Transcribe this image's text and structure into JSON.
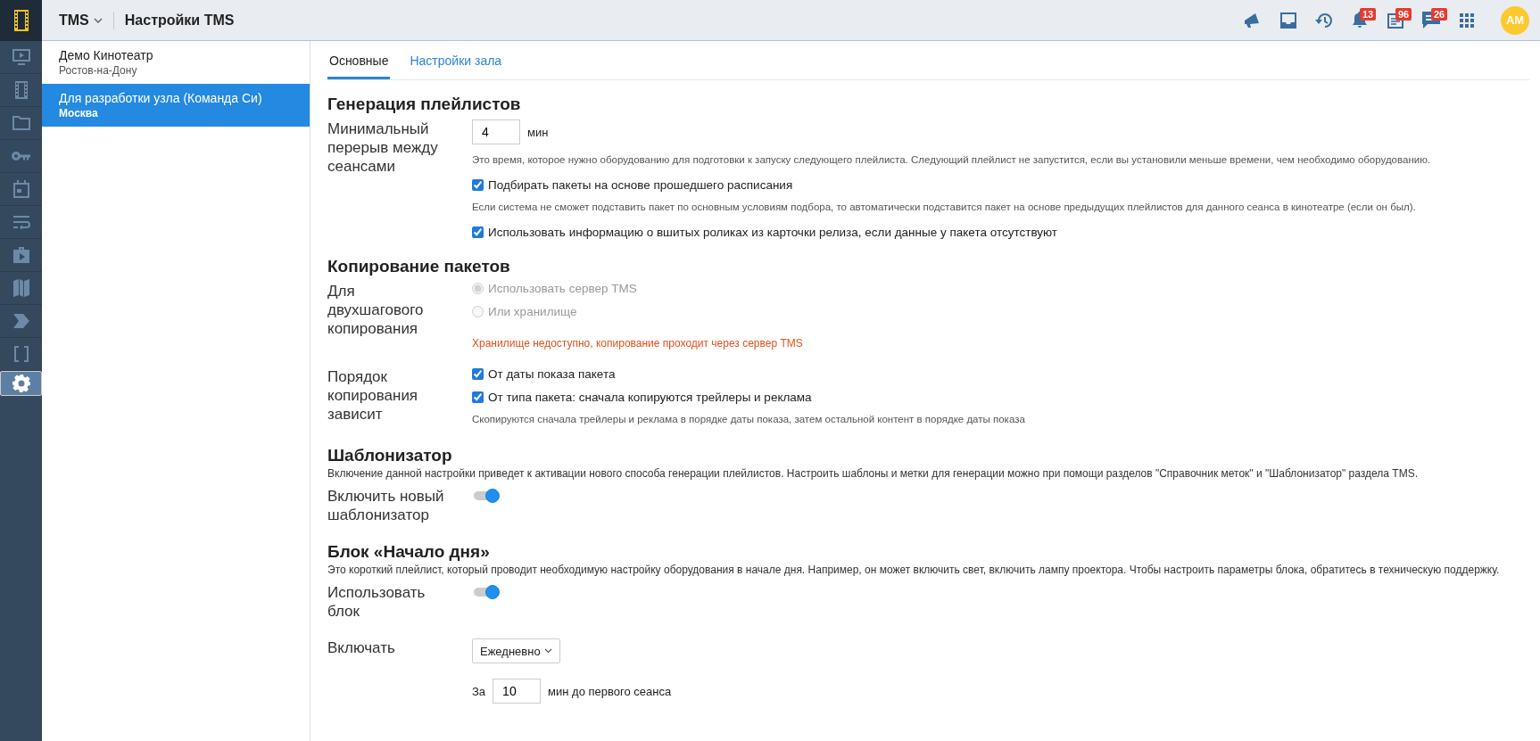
{
  "header": {
    "app": "TMS",
    "title": "Настройки TMS",
    "avatar": "AM"
  },
  "toolbar": [
    {
      "kind": "announce"
    },
    {
      "kind": "inbox"
    },
    {
      "kind": "history"
    },
    {
      "kind": "alerts",
      "badge": "13"
    },
    {
      "kind": "tasks",
      "badge": "96"
    },
    {
      "kind": "messages",
      "badge": "26"
    },
    {
      "kind": "apps"
    }
  ],
  "nav": [
    {
      "selected": false
    },
    {
      "selected": false
    },
    {
      "selected": false
    },
    {
      "selected": false
    },
    {
      "selected": false
    },
    {
      "selected": false
    },
    {
      "selected": false
    },
    {
      "selected": false
    },
    {
      "selected": false
    },
    {
      "selected": false
    },
    {
      "selected": true
    }
  ],
  "cinemas": [
    {
      "name": "Демо Кинотеатр",
      "city": "Ростов-на-Дону",
      "selected": false
    },
    {
      "name": "Для разработки узла (Команда Си)",
      "city": "Москва",
      "selected": true
    }
  ],
  "tabs": [
    {
      "label": "Основные",
      "selected": true
    },
    {
      "label": "Настройки зала",
      "selected": false
    }
  ],
  "sections": [
    {
      "title": "Генерация плейлистов",
      "rows": [
        {
          "label": "Минимальный перерыв между сеансами",
          "items": [
            {
              "kind": "number",
              "value": "4",
              "unit": "мин"
            },
            {
              "kind": "hint",
              "text": "Это время, которое нужно оборудованию для подготовки к запуску следующего плейлиста. Следующий плейлист не запустится, если вы установили меньше времени, чем необходимо оборудованию."
            },
            {
              "kind": "checkbox",
              "label": "Подбирать пакеты на основе прошедшего расписания",
              "checked": true
            },
            {
              "kind": "hint",
              "text": "Если система не сможет подставить пакет по основным условиям подбора, то автоматически подставится пакет на основе предыдущих плейлистов для данного сеанса в кинотеатре (если он был)."
            },
            {
              "kind": "checkbox",
              "label": "Использовать информацию о вшитых роликах из карточки релиза, если данные у пакета отсутствуют",
              "checked": true
            }
          ]
        }
      ]
    },
    {
      "title": "Копирование пакетов",
      "rows": [
        {
          "label": "Для двухшагового копирования",
          "items": [
            {
              "kind": "radio",
              "label": "Использовать сервер TMS",
              "selected": true,
              "disabled": true
            },
            {
              "kind": "radio",
              "label": "Или хранилище",
              "selected": false,
              "disabled": true
            },
            {
              "kind": "warning",
              "text": "Хранилище недоступно, копирование проходит через сервер TMS"
            }
          ]
        },
        {
          "label": "Порядок копирования зависит",
          "items": [
            {
              "kind": "checkbox",
              "label": "От даты показа пакета",
              "checked": true
            },
            {
              "kind": "checkbox",
              "label": "От типа пакета: сначала копируются трейлеры и реклама",
              "checked": true
            },
            {
              "kind": "hint",
              "text": "Скопируются сначала трейлеры и реклама в порядке даты показа, затем остальной контент в порядке даты показа"
            }
          ]
        }
      ]
    },
    {
      "title": "Шаблонизатор",
      "description": "Включение данной настройки приведет к активации нового способа генерации плейлистов. Настроить шаблоны и метки для генерации можно при помощи разделов \"Справочник меток\" и \"Шаблонизатор\" раздела TMS.",
      "rows": [
        {
          "label": "Включить новый шаблонизатор",
          "items": [
            {
              "kind": "toggle",
              "on": true
            }
          ]
        }
      ]
    },
    {
      "title": "Блок «Начало дня»",
      "description": "Это короткий плейлист, который проводит необходимую настройку оборудования в начале дня. Например, он может включить свет, включить лампу проектора. Чтобы настроить параметры блока, обратитесь в техническую поддержку.",
      "rows": [
        {
          "label": "Использовать блок",
          "items": [
            {
              "kind": "toggle",
              "on": true
            }
          ]
        },
        {
          "label": "Включать",
          "items": [
            {
              "kind": "select",
              "value": "Ежедневно"
            },
            {
              "kind": "number",
              "prefix": "За",
              "value": "10",
              "unit": "мин до первого сеанса"
            }
          ]
        }
      ]
    }
  ]
}
